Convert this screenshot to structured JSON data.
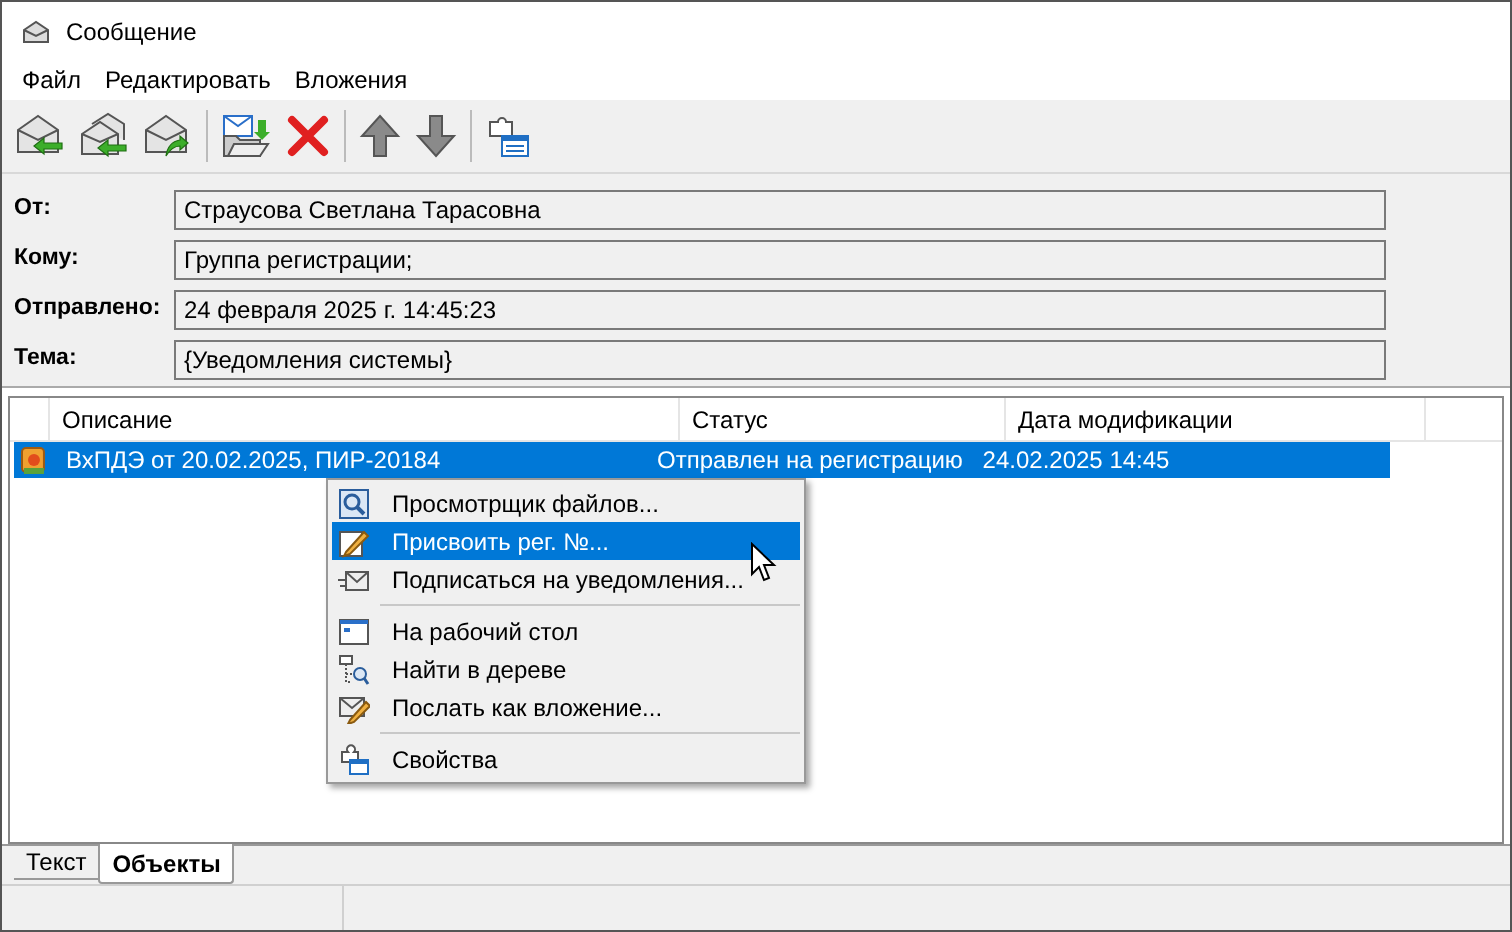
{
  "window": {
    "title": "Сообщение"
  },
  "menu_bar": [
    "Файл",
    "Редактировать",
    "Вложения"
  ],
  "header_fields": [
    {
      "label": "От:",
      "value": "Страусова Светлана Тарасовна"
    },
    {
      "label": "Кому:",
      "value": "Группа регистрации;"
    },
    {
      "label": "Отправлено:",
      "value": "24 февраля 2025 г.  14:45:23"
    },
    {
      "label": "Тема:",
      "value": "{Уведомления системы}"
    }
  ],
  "table": {
    "columns": [
      "Описание",
      "Статус",
      "Дата модификации"
    ],
    "rows": [
      {
        "selected": true,
        "cells": [
          "ВхПДЭ от 20.02.2025, ПИР-20184",
          "Отправлен на регистрацию",
          "24.02.2025 14:45"
        ]
      }
    ]
  },
  "context_menu": [
    {
      "kind": "item",
      "label": "Просмотрщик файлов...",
      "selected": false
    },
    {
      "kind": "item",
      "label": "Присвоить рег. №...",
      "selected": true
    },
    {
      "kind": "item",
      "label": "Подписаться на уведомления...",
      "selected": false
    },
    {
      "kind": "separator"
    },
    {
      "kind": "item",
      "label": "На рабочий стол",
      "selected": false
    },
    {
      "kind": "item",
      "label": "Найти в дереве",
      "selected": false
    },
    {
      "kind": "item",
      "label": "Послать как вложение...",
      "selected": false
    },
    {
      "kind": "separator"
    },
    {
      "kind": "item",
      "label": "Свойства",
      "selected": false
    }
  ],
  "bottom_tabs": [
    {
      "label": "Текст",
      "selected": false
    },
    {
      "label": "Объекты",
      "selected": true
    }
  ]
}
